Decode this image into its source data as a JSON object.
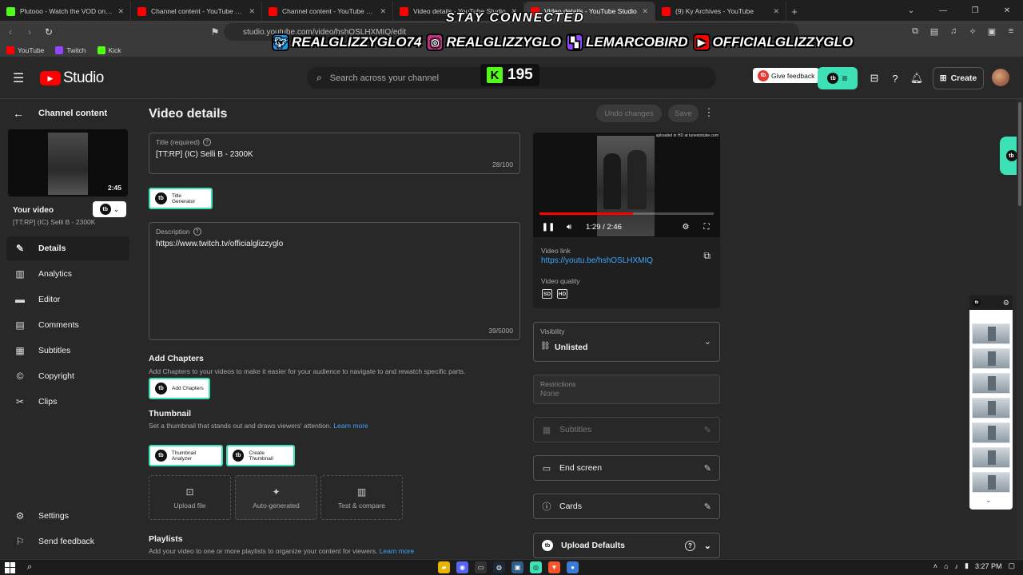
{
  "browser": {
    "tabs": [
      {
        "label": "Plutooo - Watch the VOD on Kick",
        "favicon_color": "#53fc18",
        "active": false
      },
      {
        "label": "Channel content - YouTube Studio",
        "favicon_color": "#ff0000",
        "active": false
      },
      {
        "label": "Channel content - YouTube Studio",
        "favicon_color": "#ff0000",
        "active": false
      },
      {
        "label": "Video details - YouTube Studio",
        "favicon_color": "#ff0000",
        "active": false
      },
      {
        "label": "Video details - YouTube Studio",
        "favicon_color": "#ff0000",
        "active": true
      },
      {
        "label": "(9) Ky Archives - YouTube",
        "favicon_color": "#ff0000",
        "active": false
      }
    ],
    "new_tab_icon": "plus-icon",
    "window_controls": [
      "chevron-down-icon",
      "minimize-icon",
      "maximize-icon",
      "close-icon"
    ],
    "url": "studio.youtube.com/video/hshOSLHXMIQ/edit",
    "bookmarks": [
      {
        "label": "YouTube",
        "color": "#ff0000"
      },
      {
        "label": "Twitch",
        "color": "#9146ff"
      },
      {
        "label": "Kick",
        "color": "#53fc18"
      }
    ]
  },
  "overlay": {
    "title": "STAY CONNECTED",
    "socials": [
      {
        "handle": "REALGLIZZYGLO74",
        "icon": "twitter-icon",
        "color": "#1d9bf0"
      },
      {
        "handle": "REALGLIZZYGLO",
        "icon": "instagram-icon",
        "color": "#c13584"
      },
      {
        "handle": "LEMARCOBIRD",
        "icon": "twitch-icon",
        "color": "#9146ff"
      },
      {
        "handle": "OFFICIALGLIZZYGLO",
        "icon": "youtube-icon",
        "color": "#ff0000"
      }
    ],
    "kick_letter": "K",
    "kick_viewers": "195"
  },
  "header": {
    "logo_text": "Studio",
    "search_placeholder": "Search across your channel",
    "feedback_label": "Give feedback",
    "create_label": "Create"
  },
  "sidebar": {
    "back_label": "Channel content",
    "thumb_duration": "2:45",
    "your_video_label": "Your video",
    "video_title": "[TT:RP] (IC) Selli B - 2300K",
    "items": [
      {
        "label": "Details",
        "icon": "pencil-icon",
        "active": true
      },
      {
        "label": "Analytics",
        "icon": "analytics-icon",
        "active": false
      },
      {
        "label": "Editor",
        "icon": "editor-icon",
        "active": false
      },
      {
        "label": "Comments",
        "icon": "comments-icon",
        "active": false
      },
      {
        "label": "Subtitles",
        "icon": "subtitles-icon",
        "active": false
      },
      {
        "label": "Copyright",
        "icon": "copyright-icon",
        "active": false
      },
      {
        "label": "Clips",
        "icon": "scissors-icon",
        "active": false
      }
    ],
    "settings_label": "Settings",
    "send_feedback_label": "Send feedback"
  },
  "main": {
    "page_title": "Video details",
    "undo_label": "Undo changes",
    "save_label": "Save",
    "title_field": {
      "label": "Title (required)",
      "value": "[TT:RP] (IC) Selli B - 2300K",
      "count": "28/100"
    },
    "title_generator_label": "Title Generator",
    "description_field": {
      "label": "Description",
      "value": "https://www.twitch.tv/officialglizzyglo",
      "count": "39/5000"
    },
    "chapters": {
      "title": "Add Chapters",
      "desc": "Add Chapters to your videos to make it easier for your audience to navigate to and rewatch specific parts.",
      "button_label": "Add Chapters"
    },
    "thumbnail": {
      "title": "Thumbnail",
      "desc": "Set a thumbnail that stands out and draws viewers' attention.",
      "learn_more": "Learn more",
      "analyzer_label": "Thumbnail Analyzer",
      "create_label": "Create Thumbnail",
      "options": [
        {
          "label": "Upload file",
          "icon": "upload-image-icon"
        },
        {
          "label": "Auto-generated",
          "icon": "sparkle-icon"
        },
        {
          "label": "Test & compare",
          "icon": "bar-chart-icon"
        }
      ]
    },
    "playlists": {
      "title": "Playlists",
      "desc": "Add your video to one or more playlists to organize your content for viewers.",
      "learn_more": "Learn more"
    }
  },
  "right": {
    "player": {
      "watermark": "uploaded in HD at tunestotube.com",
      "time": "1:29 / 2:46",
      "progress_fraction": 0.535
    },
    "video_link_label": "Video link",
    "video_link": "https://youtu.be/hshOSLHXMIQ",
    "video_quality_label": "Video quality",
    "quality_badges": [
      "SD",
      "HD"
    ],
    "visibility_label": "Visibility",
    "visibility_value": "Unlisted",
    "restrictions_label": "Restrictions",
    "restrictions_value": "None",
    "subtitles_label": "Subtitles",
    "end_screen_label": "End screen",
    "cards_label": "Cards",
    "upload_defaults_label": "Upload Defaults"
  },
  "taskbar": {
    "time": "3:27 PM"
  }
}
